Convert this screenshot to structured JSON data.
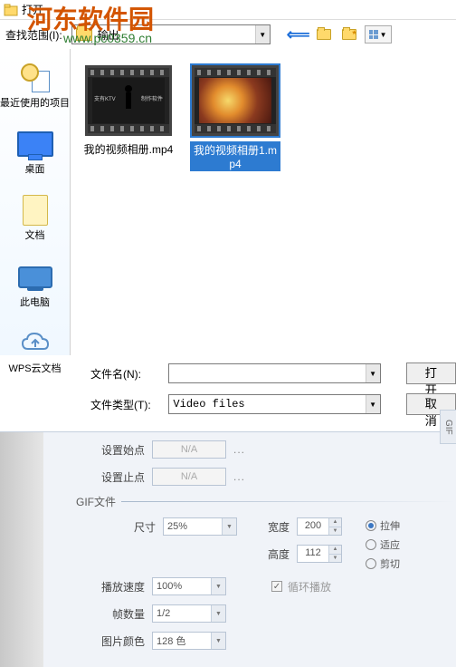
{
  "title": "打开",
  "watermark": {
    "main": "河东软件园",
    "sub": "www.pc0359.cn"
  },
  "toolbar": {
    "range_label": "查找范围(I):",
    "folder_name": "输出"
  },
  "sidebar": {
    "recent": "最近使用的项目",
    "desktop": "桌面",
    "documents": "文档",
    "this_pc": "此电脑",
    "wps_cloud": "WPS云文档"
  },
  "files": [
    {
      "name": "我的视频相册.mp4"
    },
    {
      "name": "我的视频相册1.mp4"
    }
  ],
  "thumb_ktv": {
    "left": "支有KTV",
    "right": "制作软件"
  },
  "form": {
    "filename_label": "文件名(N):",
    "filename_value": "",
    "filetype_label": "文件类型(T):",
    "filetype_value": "Video files",
    "open_btn": "打开",
    "cancel_btn": "取消"
  },
  "lower": {
    "set_start": "设置始点",
    "set_end": "设置止点",
    "na": "N/A",
    "gif_section": "GIF文件",
    "size_label": "尺寸",
    "size_value": "25%",
    "width_label": "宽度",
    "width_value": "200",
    "height_label": "高度",
    "height_value": "112",
    "stretch": "拉伸",
    "fit": "适应",
    "crop": "剪切",
    "speed_label": "播放速度",
    "speed_value": "100%",
    "loop": "循环播放",
    "frames_label": "帧数量",
    "frames_value": "1/2",
    "colors_label": "图片颜色",
    "colors_value": "128 色",
    "gif_tab": "GIF"
  }
}
